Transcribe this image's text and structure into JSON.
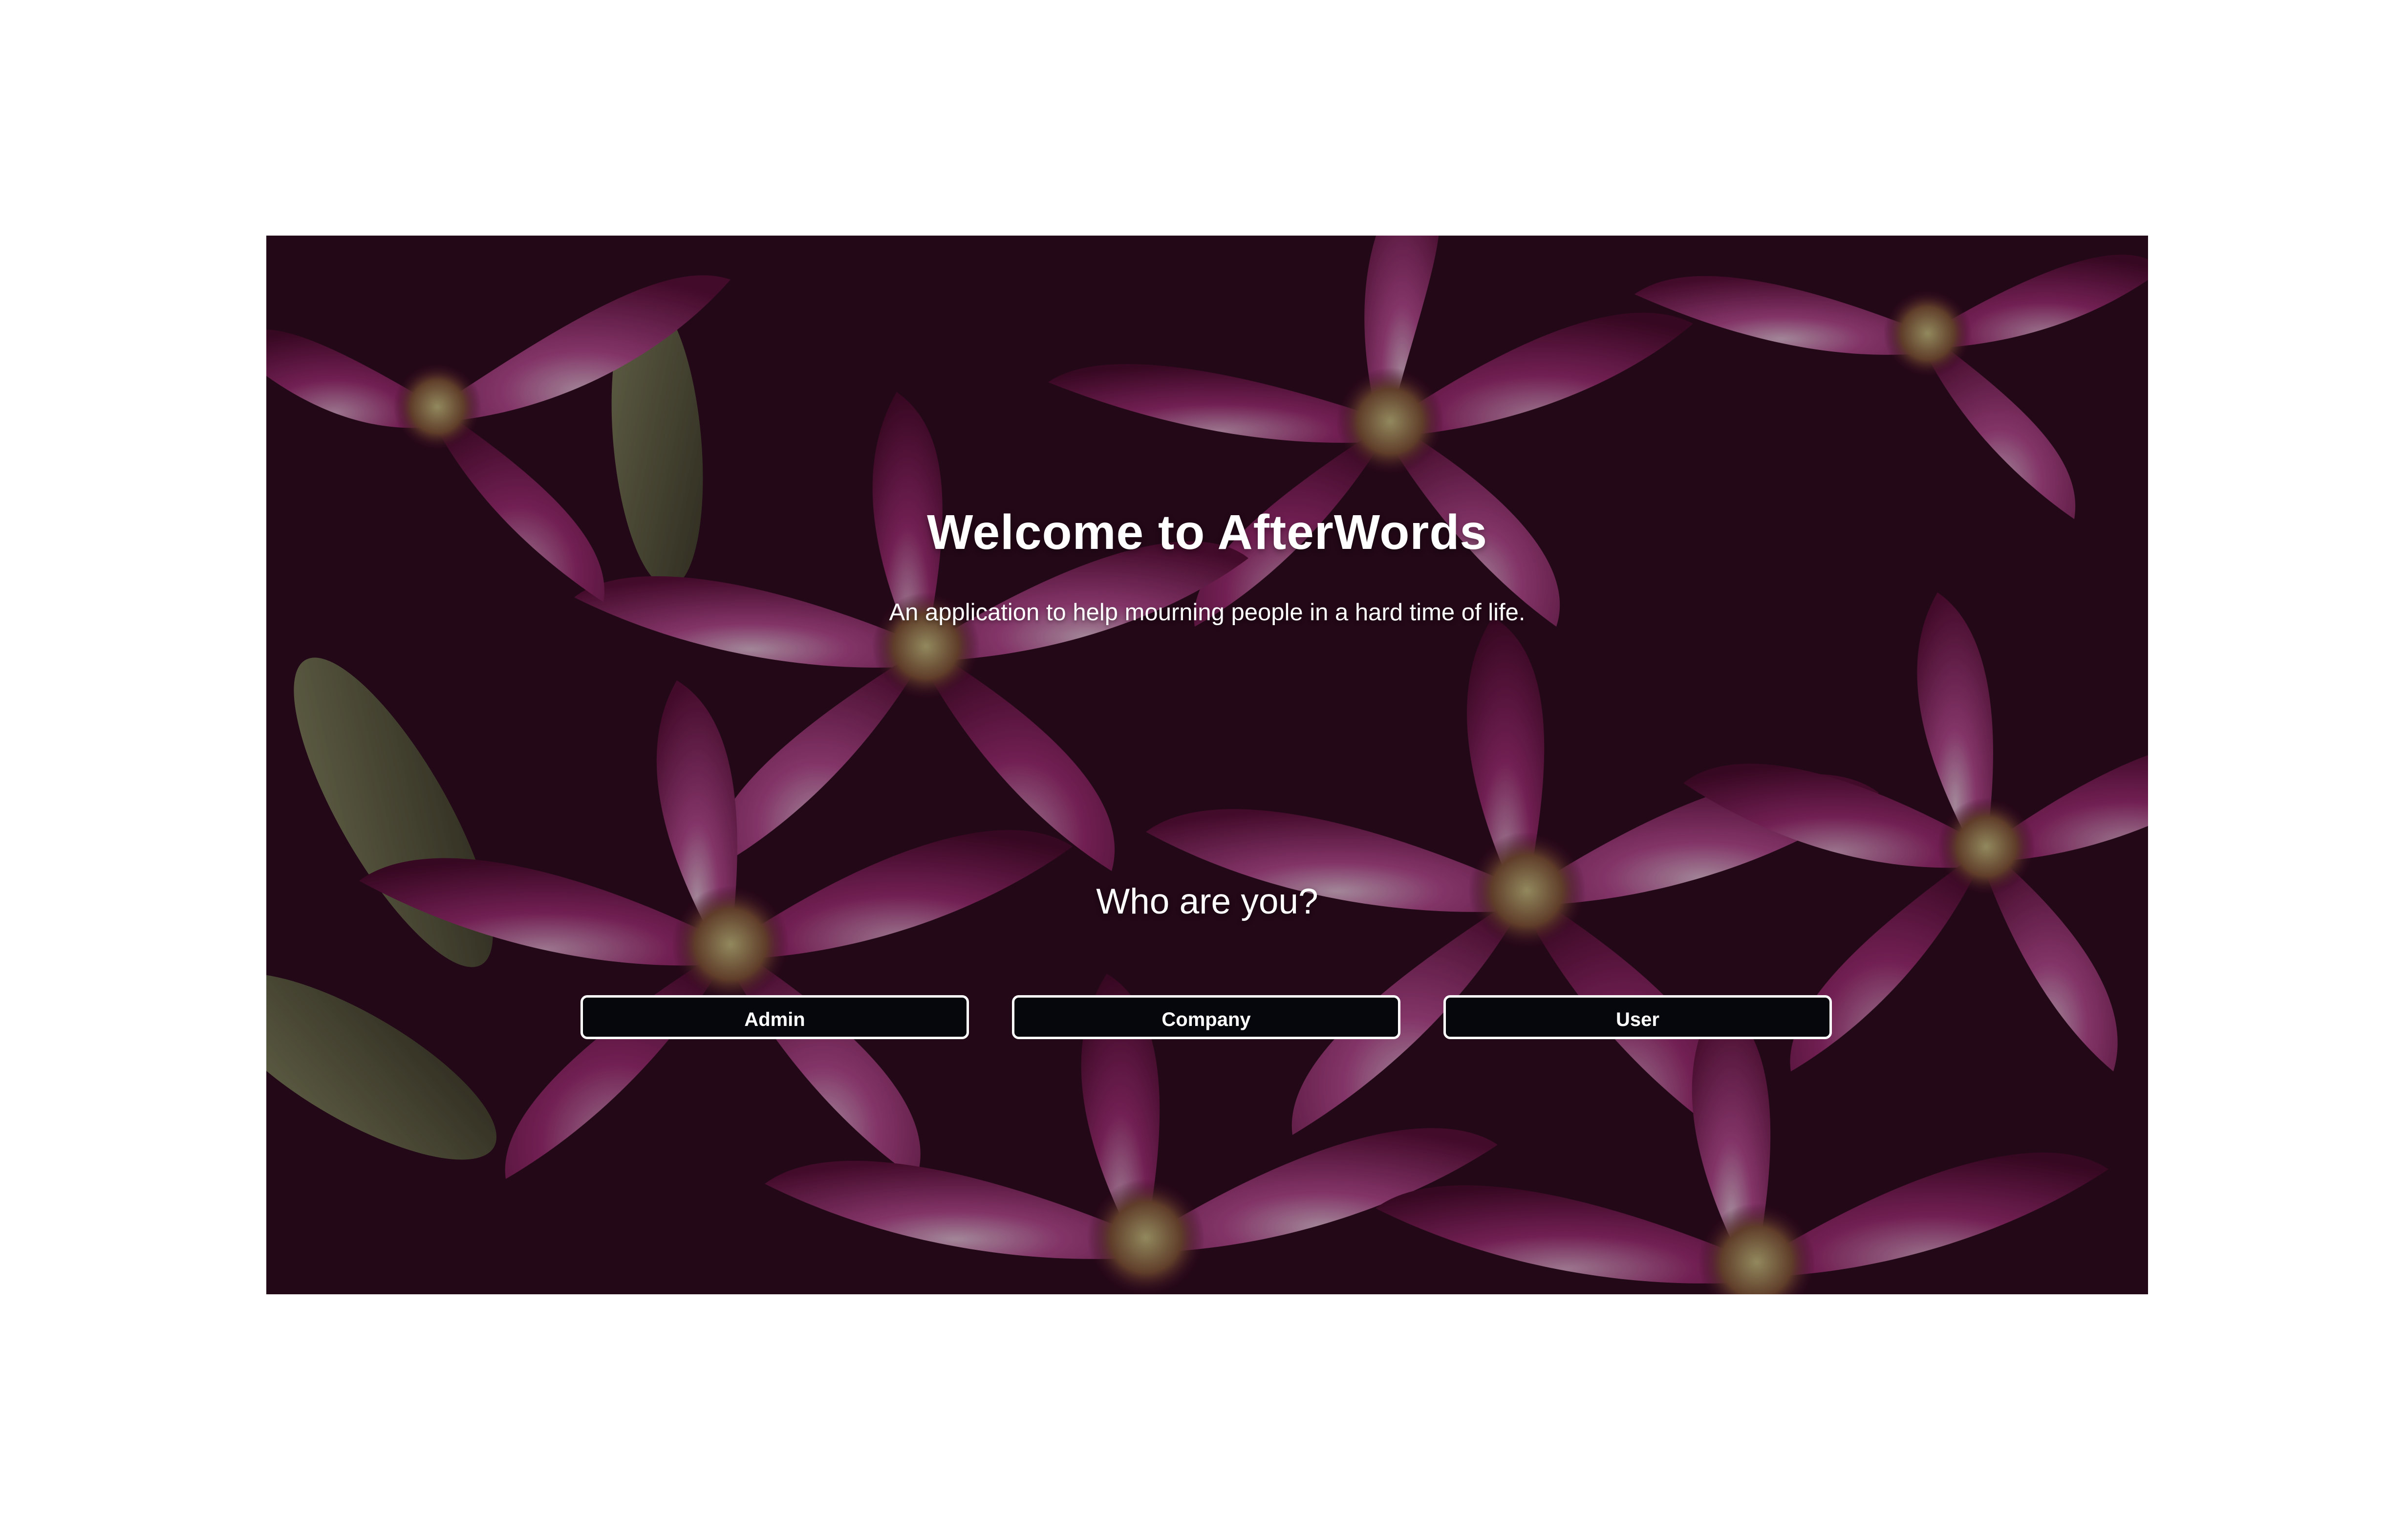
{
  "hero": {
    "title": "Welcome to AfterWords",
    "subtitle": "An application to help mourning people in a hard time of life.",
    "question": "Who are you?"
  },
  "roles": {
    "admin_label": "Admin",
    "company_label": "Company",
    "user_label": "User"
  },
  "colors": {
    "page_background": "#ffffff",
    "button_background": "#05070d",
    "button_border": "#ffffff",
    "text": "#ffffff",
    "flower_primary": "#8a1c5c",
    "flower_light": "#d9a6c8",
    "bud_green": "#6f7a4e"
  },
  "background_image": "magenta-lily-flowers"
}
